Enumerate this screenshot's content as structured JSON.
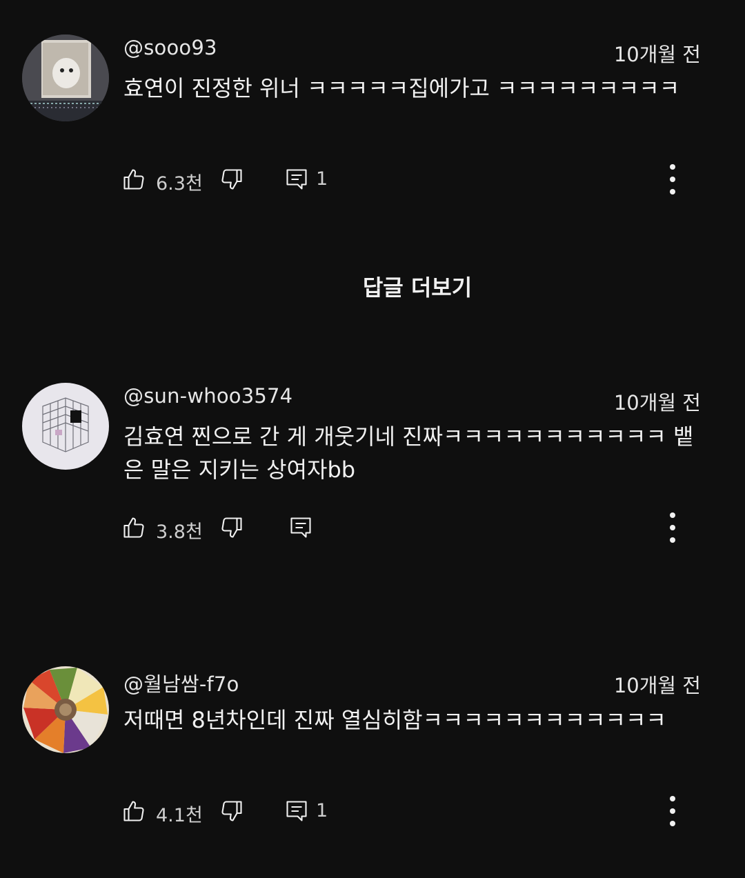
{
  "comments": [
    {
      "handle": "@sooo93",
      "time": "10개월 전",
      "text": "효연이 진정한 위너 ㅋㅋㅋㅋㅋ집에가고 ㅋㅋㅋㅋㅋㅋㅋㅋㅋ",
      "likes": "6.3천",
      "replies": "1"
    },
    {
      "handle": "@sun-whoo3574",
      "time": "10개월 전",
      "text": "김효연 찐으로 간 게 개웃기네 진짜ㅋㅋㅋㅋㅋㅋㅋㅋㅋㅋㅋ 뱉은 말은 지키는 상여자bb",
      "likes": "3.8천",
      "replies": ""
    },
    {
      "handle": "@월남쌈-f7o",
      "time": "10개월 전",
      "text": "저때면 8년차인데 진짜 열심히함ㅋㅋㅋㅋㅋㅋㅋㅋㅋㅋㅋㅋ",
      "likes": "4.1천",
      "replies": "1"
    }
  ],
  "more_replies_label": "답글 더보기",
  "icons": {
    "like": "thumbs-up-icon",
    "dislike": "thumbs-down-icon",
    "reply": "comment-icon",
    "menu": "more-vert-icon"
  }
}
